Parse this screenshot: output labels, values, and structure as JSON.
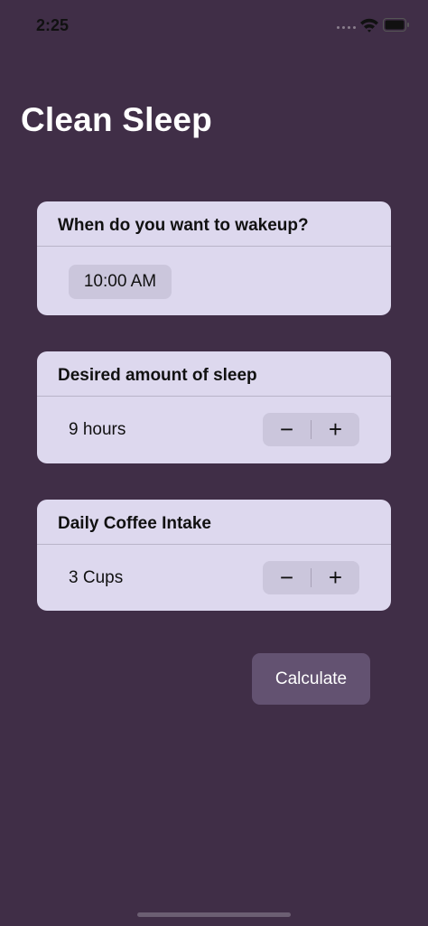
{
  "status_bar": {
    "time": "2:25",
    "icons": [
      "cellular-dots-icon",
      "wifi-icon",
      "battery-icon"
    ]
  },
  "app": {
    "title": "Clean Sleep"
  },
  "wakeup_card": {
    "header": "When do you want to wakeup?",
    "time_value": "10:00 AM"
  },
  "sleep_card": {
    "header": "Desired amount of sleep",
    "value": "9 hours",
    "minus": "−",
    "plus": "+"
  },
  "coffee_card": {
    "header": "Daily Coffee Intake",
    "value": "3 Cups",
    "minus": "−",
    "plus": "+"
  },
  "actions": {
    "calculate_label": "Calculate"
  },
  "colors": {
    "background": "#402e47",
    "card": "#ddd8ee",
    "control": "#cbc6dc",
    "button": "#635271"
  }
}
